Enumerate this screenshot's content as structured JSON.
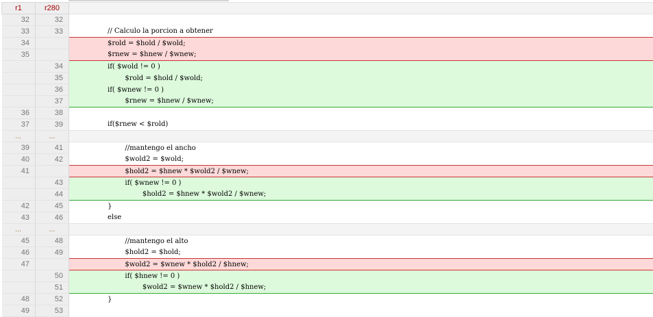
{
  "header": {
    "left_rev": "r1",
    "right_rev": "r280"
  },
  "lines": [
    {
      "type": "ctx",
      "old": "32",
      "new": "32",
      "code": ""
    },
    {
      "type": "ctx",
      "old": "33",
      "new": "33",
      "code": "// Calculo la porcion a obtener"
    },
    {
      "type": "rem",
      "old": "34",
      "new": "",
      "code": "$rold = $hold / $wold;",
      "pos": "first"
    },
    {
      "type": "rem",
      "old": "35",
      "new": "",
      "code": "$rnew = $hnew / $wnew;",
      "pos": "last"
    },
    {
      "type": "add",
      "old": "",
      "new": "34",
      "code": "if( $wold != 0 )",
      "pos": "first"
    },
    {
      "type": "add",
      "old": "",
      "new": "35",
      "code": "        $rold = $hold / $wold;",
      "pos": ""
    },
    {
      "type": "add",
      "old": "",
      "new": "36",
      "code": "if( $wnew != 0 )",
      "pos": ""
    },
    {
      "type": "add",
      "old": "",
      "new": "37",
      "code": "        $rnew = $hnew / $wnew;",
      "pos": "last"
    },
    {
      "type": "ctx",
      "old": "36",
      "new": "38",
      "code": ""
    },
    {
      "type": "ctx",
      "old": "37",
      "new": "39",
      "code": "if($rnew < $rold)"
    },
    {
      "type": "skip",
      "old": "...",
      "new": "...",
      "code": ""
    },
    {
      "type": "ctx",
      "old": "39",
      "new": "41",
      "code": "        //mantengo el ancho"
    },
    {
      "type": "ctx",
      "old": "40",
      "new": "42",
      "code": "        $wold2 = $wold;"
    },
    {
      "type": "rem",
      "old": "41",
      "new": "",
      "code": "        $hold2 = $hnew * $wold2 / $wnew;",
      "pos": "first last"
    },
    {
      "type": "add",
      "old": "",
      "new": "43",
      "code": "        if( $wnew != 0 )",
      "pos": "first"
    },
    {
      "type": "add",
      "old": "",
      "new": "44",
      "code": "                $hold2 = $hnew * $wold2 / $wnew;",
      "pos": "last"
    },
    {
      "type": "ctx",
      "old": "42",
      "new": "45",
      "code": "}"
    },
    {
      "type": "ctx",
      "old": "43",
      "new": "46",
      "code": "else"
    },
    {
      "type": "skip",
      "old": "...",
      "new": "...",
      "code": ""
    },
    {
      "type": "ctx",
      "old": "45",
      "new": "48",
      "code": "        //mantengo el alto"
    },
    {
      "type": "ctx",
      "old": "46",
      "new": "49",
      "code": "        $hold2 = $hold;"
    },
    {
      "type": "rem",
      "old": "47",
      "new": "",
      "code": "        $wold2 = $wnew * $hold2 / $hnew;",
      "pos": "first last"
    },
    {
      "type": "add",
      "old": "",
      "new": "50",
      "code": "        if( $hnew != 0 )",
      "pos": "first"
    },
    {
      "type": "add",
      "old": "",
      "new": "51",
      "code": "                $wold2 = $wnew * $hold2 / $hnew;",
      "pos": "last"
    },
    {
      "type": "ctx",
      "old": "48",
      "new": "52",
      "code": "}"
    },
    {
      "type": "ctx",
      "old": "49",
      "new": "53",
      "code": ""
    }
  ]
}
